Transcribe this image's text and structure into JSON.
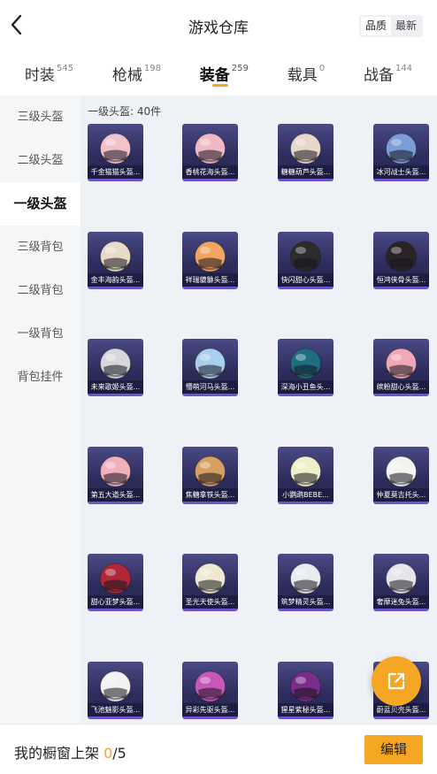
{
  "header": {
    "title": "游戏仓库",
    "sort_options": [
      "品质",
      "最新"
    ],
    "sort_active": 0
  },
  "tabs": [
    {
      "label": "时装",
      "count": "545"
    },
    {
      "label": "枪械",
      "count": "198"
    },
    {
      "label": "装备",
      "count": "259",
      "active": true
    },
    {
      "label": "载具",
      "count": "0"
    },
    {
      "label": "战备",
      "count": "144"
    }
  ],
  "sidebar": {
    "items": [
      "三级头盔",
      "二级头盔",
      "一级头盔",
      "三级背包",
      "二级背包",
      "一级背包",
      "背包挂件"
    ],
    "active": 2
  },
  "content": {
    "section_label": "一级头盔: 40件",
    "items": [
      {
        "name": "千金猫猫头盔...",
        "color": "#f2c2cc"
      },
      {
        "name": "香桃花海头盔...",
        "color": "#f0b8c4"
      },
      {
        "name": "糖糖葫芦头盔...",
        "color": "#e8d8cc"
      },
      {
        "name": "冰河战士头盔...",
        "color": "#7a9cd8"
      },
      {
        "name": "金丰海韵头盔...",
        "color": "#e8dcc8"
      },
      {
        "name": "祥瑞貔貅头盔...",
        "color": "#f0a460"
      },
      {
        "name": "快闪甜心头盔...",
        "color": "#2c2c2c"
      },
      {
        "name": "恒鸿侠骨头盔...",
        "color": "#2a2426"
      },
      {
        "name": "未来歌姬头盔...",
        "color": "#d8d8dc"
      },
      {
        "name": "懵萌河马头盔...",
        "color": "#a8d0ec"
      },
      {
        "name": "深海小丑鱼头...",
        "color": "#1e6e80"
      },
      {
        "name": "缤粉甜心头盔...",
        "color": "#f0a8b4"
      },
      {
        "name": "第五大道头盔...",
        "color": "#f0b0bc"
      },
      {
        "name": "焦糖拿铁头盔...",
        "color": "#d8a060"
      },
      {
        "name": "小鹦鹉BEBE...",
        "color": "#eef0c8"
      },
      {
        "name": "仲夏莫吉托头...",
        "color": "#f2f4f2"
      },
      {
        "name": "甜心亚梦头盔...",
        "color": "#b02838"
      },
      {
        "name": "圣光天使头盔...",
        "color": "#f0e8d0"
      },
      {
        "name": "筑梦精灵头盔...",
        "color": "#e8ecf0"
      },
      {
        "name": "奢靡迷兔头盔...",
        "color": "#e8e4ec"
      },
      {
        "name": "飞池魅影头盔...",
        "color": "#f2f2f2"
      },
      {
        "name": "异彩先驱头盔...",
        "color": "#c858b8"
      },
      {
        "name": "猩星紫秘头盔...",
        "color": "#7a2c8c"
      },
      {
        "name": "蔚蓝贝壳头盔...",
        "color": "#f0f0f0"
      }
    ]
  },
  "bottom_bar": {
    "label": "我的橱窗上架 ",
    "current": "0",
    "max": "/5",
    "edit_label": "编辑"
  },
  "colors": {
    "accent": "#f5a623",
    "card_bg": "#33336a"
  },
  "icons": {
    "back": "chevron-left-icon",
    "share": "external-link-icon"
  }
}
